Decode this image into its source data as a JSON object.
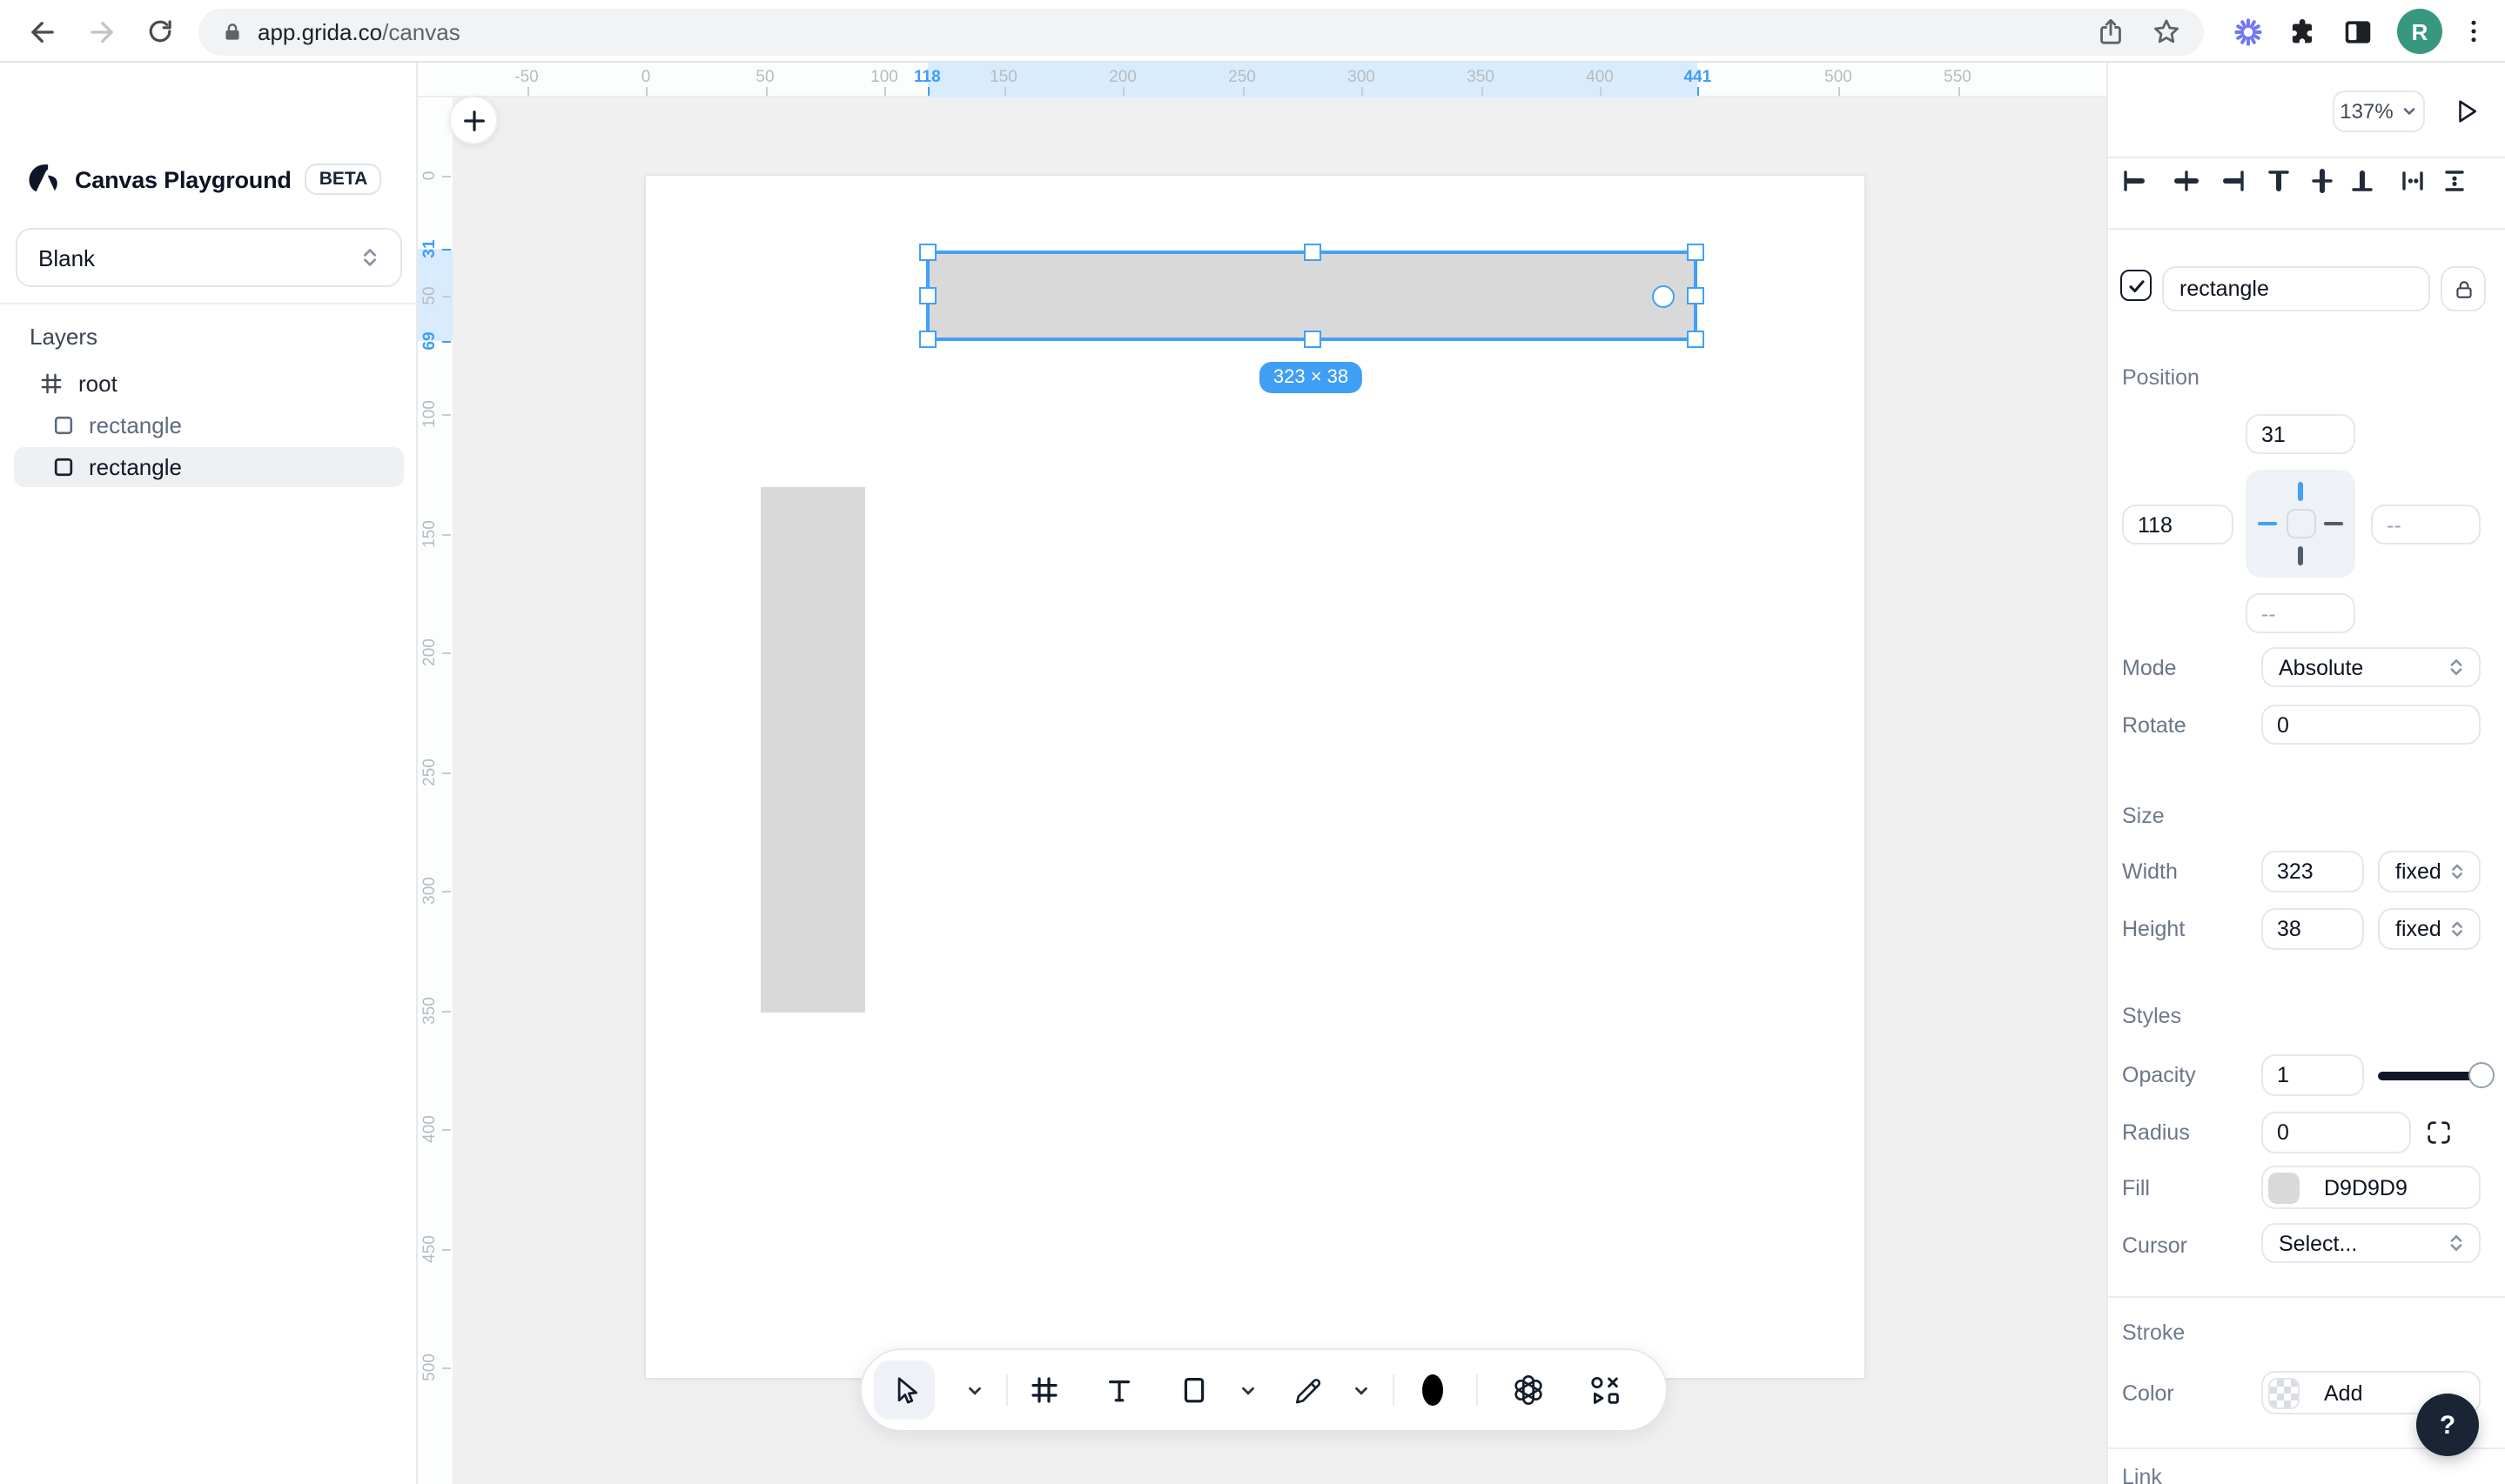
{
  "browser": {
    "url_host": "app.grida.co",
    "url_path": "/canvas",
    "avatar_letter": "R"
  },
  "sidebar": {
    "app_title": "Canvas Playground",
    "beta_badge": "BETA",
    "template_select": "Blank",
    "layers_title": "Layers",
    "layers": [
      {
        "name": "root",
        "icon": "frame-icon",
        "indent": 0,
        "selected": false
      },
      {
        "name": "rectangle",
        "icon": "rectangle-icon",
        "indent": 1,
        "selected": false
      },
      {
        "name": "rectangle",
        "icon": "rectangle-icon",
        "indent": 1,
        "selected": true
      }
    ]
  },
  "canvas": {
    "size_badge": "323 × 38",
    "h_ruler": {
      "labels": [
        {
          "v": -50
        },
        {
          "v": 0
        },
        {
          "v": 50
        },
        {
          "v": 100
        },
        {
          "v": 118,
          "hl": true
        },
        {
          "v": 150
        },
        {
          "v": 200
        },
        {
          "v": 250
        },
        {
          "v": 300
        },
        {
          "v": 350
        },
        {
          "v": 400
        },
        {
          "v": 441,
          "hl": true
        },
        {
          "v": 500
        },
        {
          "v": 550
        }
      ],
      "highlight_range": [
        118,
        441
      ]
    },
    "v_ruler": {
      "labels": [
        {
          "v": 0
        },
        {
          "v": 31,
          "hl": true
        },
        {
          "v": 50
        },
        {
          "v": 69,
          "hl": true
        },
        {
          "v": 100
        },
        {
          "v": 150
        },
        {
          "v": 200
        },
        {
          "v": 250
        },
        {
          "v": 300
        },
        {
          "v": 350
        },
        {
          "v": 400
        },
        {
          "v": 450
        },
        {
          "v": 500
        }
      ],
      "highlight_range": [
        31,
        69
      ]
    }
  },
  "toolbar_icons": [
    "cursor-icon",
    "chevron-down-icon",
    "frame-grid-icon",
    "text-tool-icon",
    "rectangle-tool-icon",
    "chevron-down-icon",
    "pencil-tool-icon",
    "chevron-down-icon",
    "ellipse-swatch-icon",
    "openai-icon",
    "shapes-icon"
  ],
  "inspector": {
    "zoom_value": "137%",
    "name_field": "rectangle",
    "position": {
      "title": "Position",
      "top": "31",
      "left": "118",
      "right": "--",
      "bottom": "--"
    },
    "mode_label": "Mode",
    "mode_value": "Absolute",
    "rotate_label": "Rotate",
    "rotate_value": "0",
    "size": {
      "title": "Size",
      "width_label": "Width",
      "width_value": "323",
      "width_unit": "fixed",
      "height_label": "Height",
      "height_value": "38",
      "height_unit": "fixed"
    },
    "styles": {
      "title": "Styles",
      "opacity_label": "Opacity",
      "opacity_value": "1",
      "radius_label": "Radius",
      "radius_value": "0",
      "fill_label": "Fill",
      "fill_value": "D9D9D9",
      "fill_swatch": "#D9D9D9",
      "cursor_label": "Cursor",
      "cursor_value": "Select..."
    },
    "stroke": {
      "title": "Stroke",
      "color_label": "Color",
      "add_label": "Add"
    },
    "link_title": "Link",
    "help_label": "?"
  },
  "colors": {
    "accent_blue": "#42A0F5",
    "ruler_band": "#D9ECFD",
    "fill_gray": "#D9D9D9",
    "dark_navy": "#101827"
  }
}
